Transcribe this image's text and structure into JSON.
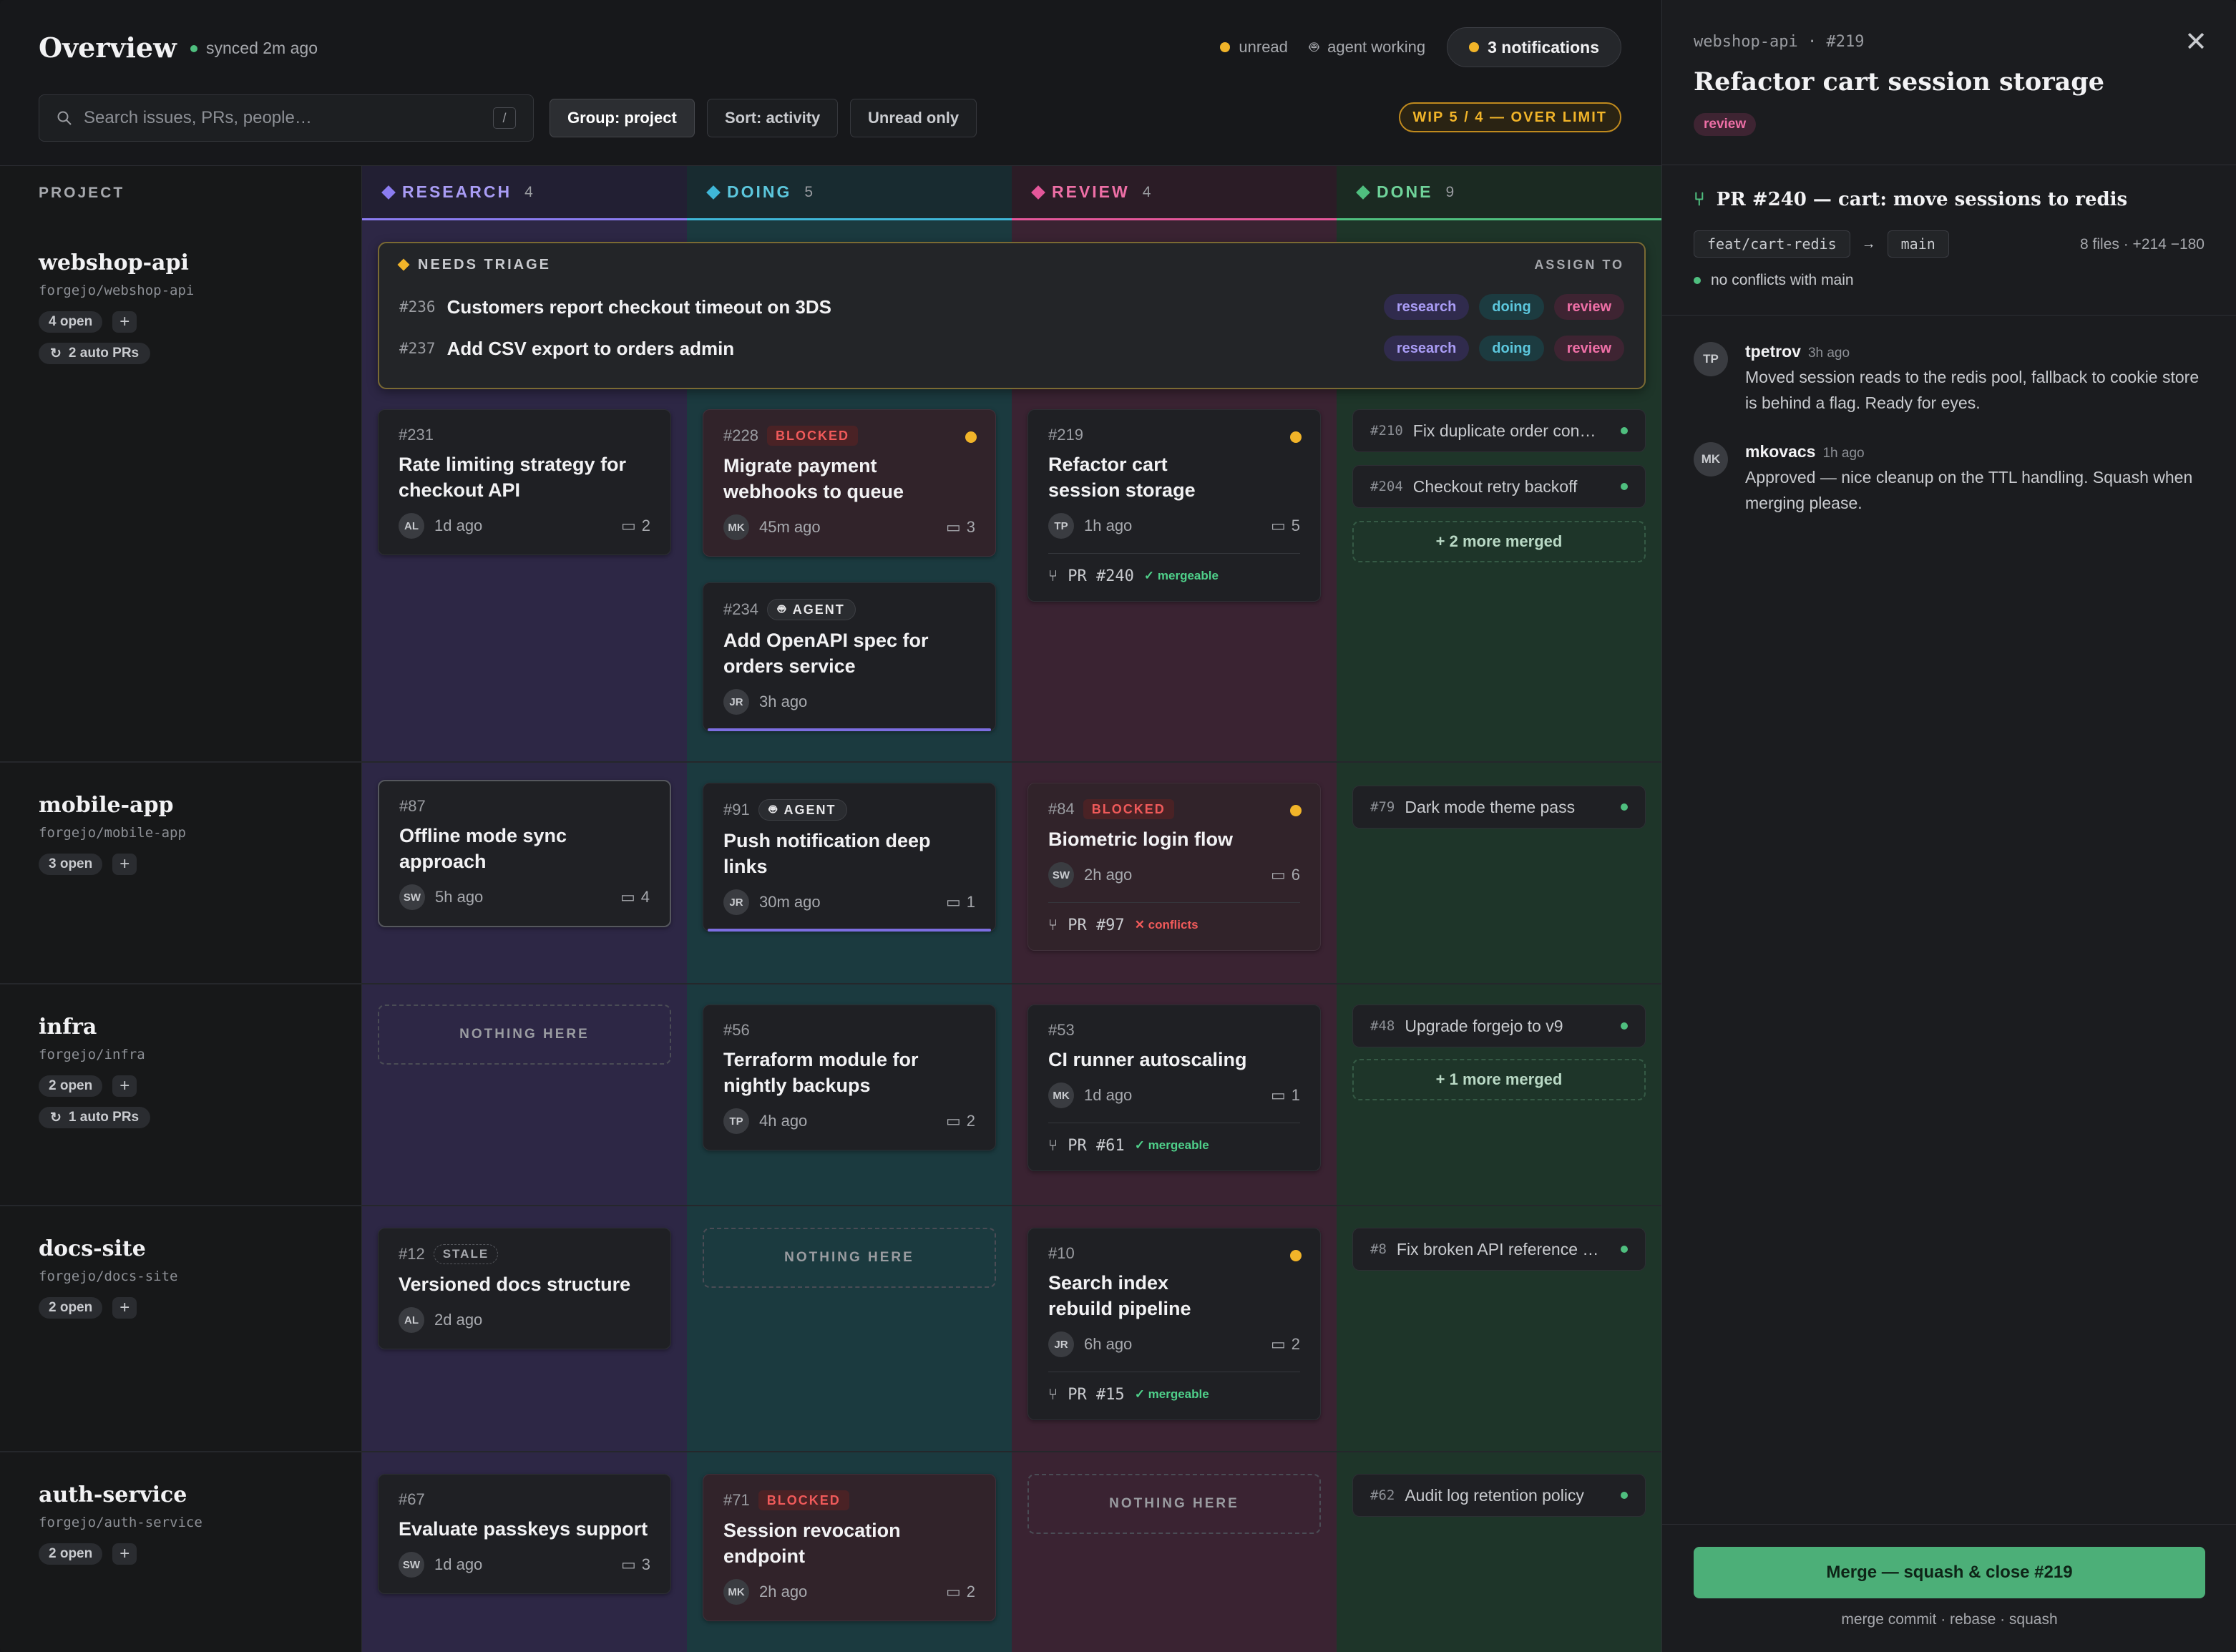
{
  "header": {
    "title": "Overview",
    "sync_status": "synced 2m ago",
    "legend_unread": "unread",
    "legend_agent": "agent working",
    "notifications": "3 notifications",
    "search_placeholder": "Search issues, PRs, people…",
    "search_shortcut": "/",
    "filters": [
      "Group: project",
      "Sort: activity",
      "Unread only"
    ],
    "wip": "WIP 5 / 4 — OVER LIMIT"
  },
  "colors": {
    "research": "#8b7cf0",
    "doing": "#3fb7d8",
    "review": "#e4579a",
    "done": "#4fbf7f",
    "unread": "#f1b429",
    "accent": "#4caf78"
  },
  "columns": [
    {
      "label": "RESEARCH",
      "count": "4"
    },
    {
      "label": "DOING",
      "count": "5"
    },
    {
      "label": "REVIEW",
      "count": "4"
    },
    {
      "label": "DONE",
      "count": "9"
    }
  ],
  "project_header": "PROJECT",
  "triage": {
    "heading": "NEEDS TRIAGE",
    "assign_to": "ASSIGN TO",
    "items": [
      {
        "id": "#236",
        "title": "Customers report checkout timeout on 3DS"
      },
      {
        "id": "#237",
        "title": "Add CSV export to orders admin"
      }
    ],
    "tags": [
      "research",
      "doing",
      "review"
    ]
  },
  "empty_label": "NOTHING HERE",
  "projects": [
    {
      "name": "webshop-api",
      "repo": "forgejo/webshop-api",
      "open": "4 open",
      "auto": "2 auto PRs"
    },
    {
      "name": "mobile-app",
      "repo": "forgejo/mobile-app",
      "open": "3 open"
    },
    {
      "name": "infra",
      "repo": "forgejo/infra",
      "open": "2 open",
      "auto": "1 auto PRs"
    },
    {
      "name": "docs-site",
      "repo": "forgejo/docs-site",
      "open": "2 open"
    },
    {
      "name": "auth-service",
      "repo": "forgejo/auth-service",
      "open": "2 open"
    }
  ],
  "cards": {
    "c231": {
      "id": "#231",
      "title": "Rate limiting strategy for checkout API",
      "who": "AL",
      "when": "1d ago",
      "comments": "2"
    },
    "c228": {
      "id": "#228",
      "badge": "BLOCKED",
      "title": "Migrate payment webhooks to queue",
      "who": "MK",
      "when": "45m ago",
      "comments": "3"
    },
    "c234": {
      "id": "#234",
      "badge": "AGENT",
      "title": "Add OpenAPI spec for orders service",
      "who": "JR",
      "when": "3h ago"
    },
    "c219": {
      "id": "#219",
      "title": "Refactor cart session storage",
      "who": "TP",
      "when": "1h ago",
      "comments": "5",
      "pr": "PR #240",
      "pr_status": "✓ mergeable"
    },
    "c87": {
      "id": "#87",
      "title": "Offline mode sync approach",
      "who": "SW",
      "when": "5h ago",
      "comments": "4"
    },
    "c91": {
      "id": "#91",
      "badge": "AGENT",
      "title": "Push notification deep links",
      "who": "JR",
      "when": "30m ago",
      "comments": "1"
    },
    "c84": {
      "id": "#84",
      "badge": "BLOCKED",
      "title": "Biometric login flow",
      "who": "SW",
      "when": "2h ago",
      "comments": "6",
      "pr": "PR #97",
      "pr_status": "✕ conflicts"
    },
    "c56": {
      "id": "#56",
      "title": "Terraform module for nightly backups",
      "who": "TP",
      "when": "4h ago",
      "comments": "2"
    },
    "c53": {
      "id": "#53",
      "title": "CI runner autoscaling",
      "who": "MK",
      "when": "1d ago",
      "comments": "1",
      "pr": "PR #61",
      "pr_status": "✓ mergeable"
    },
    "c12": {
      "id": "#12",
      "badge": "STALE",
      "title": "Versioned docs structure",
      "who": "AL",
      "when": "2d ago"
    },
    "c10": {
      "id": "#10",
      "title": "Search index rebuild pipeline",
      "who": "JR",
      "when": "6h ago",
      "comments": "2",
      "pr": "PR #15",
      "pr_status": "✓ mergeable"
    },
    "c67": {
      "id": "#67",
      "title": "Evaluate passkeys support",
      "who": "SW",
      "when": "1d ago",
      "comments": "3"
    },
    "c71": {
      "id": "#71",
      "badge": "BLOCKED",
      "title": "Session revocation endpoint",
      "who": "MK",
      "when": "2h ago",
      "comments": "2"
    }
  },
  "done": {
    "d210": {
      "id": "#210",
      "title": "Fix duplicate order con…"
    },
    "d204": {
      "id": "#204",
      "title": "Checkout retry backoff"
    },
    "more1": "+ 2 more merged",
    "d79": {
      "id": "#79",
      "title": "Dark mode theme pass"
    },
    "d48": {
      "id": "#48",
      "title": "Upgrade forgejo to v9"
    },
    "more2": "+ 1 more merged",
    "d8": {
      "id": "#8",
      "title": "Fix broken API reference …"
    },
    "d62": {
      "id": "#62",
      "title": "Audit log retention policy"
    }
  },
  "panel": {
    "repo": "webshop-api",
    "issue": "#219",
    "title": "Refactor cart session storage",
    "tag": "review",
    "pr_title": "PR #240 — cart: move sessions to redis",
    "branch_from": "feat/cart-redis",
    "branch_to": "main",
    "files": "8 files · +214 −180",
    "conflict_status": "no conflicts with main",
    "comments": [
      {
        "initials": "TP",
        "author": "tpetrov",
        "time": "3h ago",
        "text": "Moved session reads to the redis pool, fallback to cookie store is behind a flag. Ready for eyes."
      },
      {
        "initials": "MK",
        "author": "mkovacs",
        "time": "1h ago",
        "text": "Approved — nice cleanup on the TTL handling. Squash when merging please."
      }
    ],
    "merge_button": "Merge — squash & close #219",
    "merge_alternatives": "merge commit · rebase · squash"
  }
}
